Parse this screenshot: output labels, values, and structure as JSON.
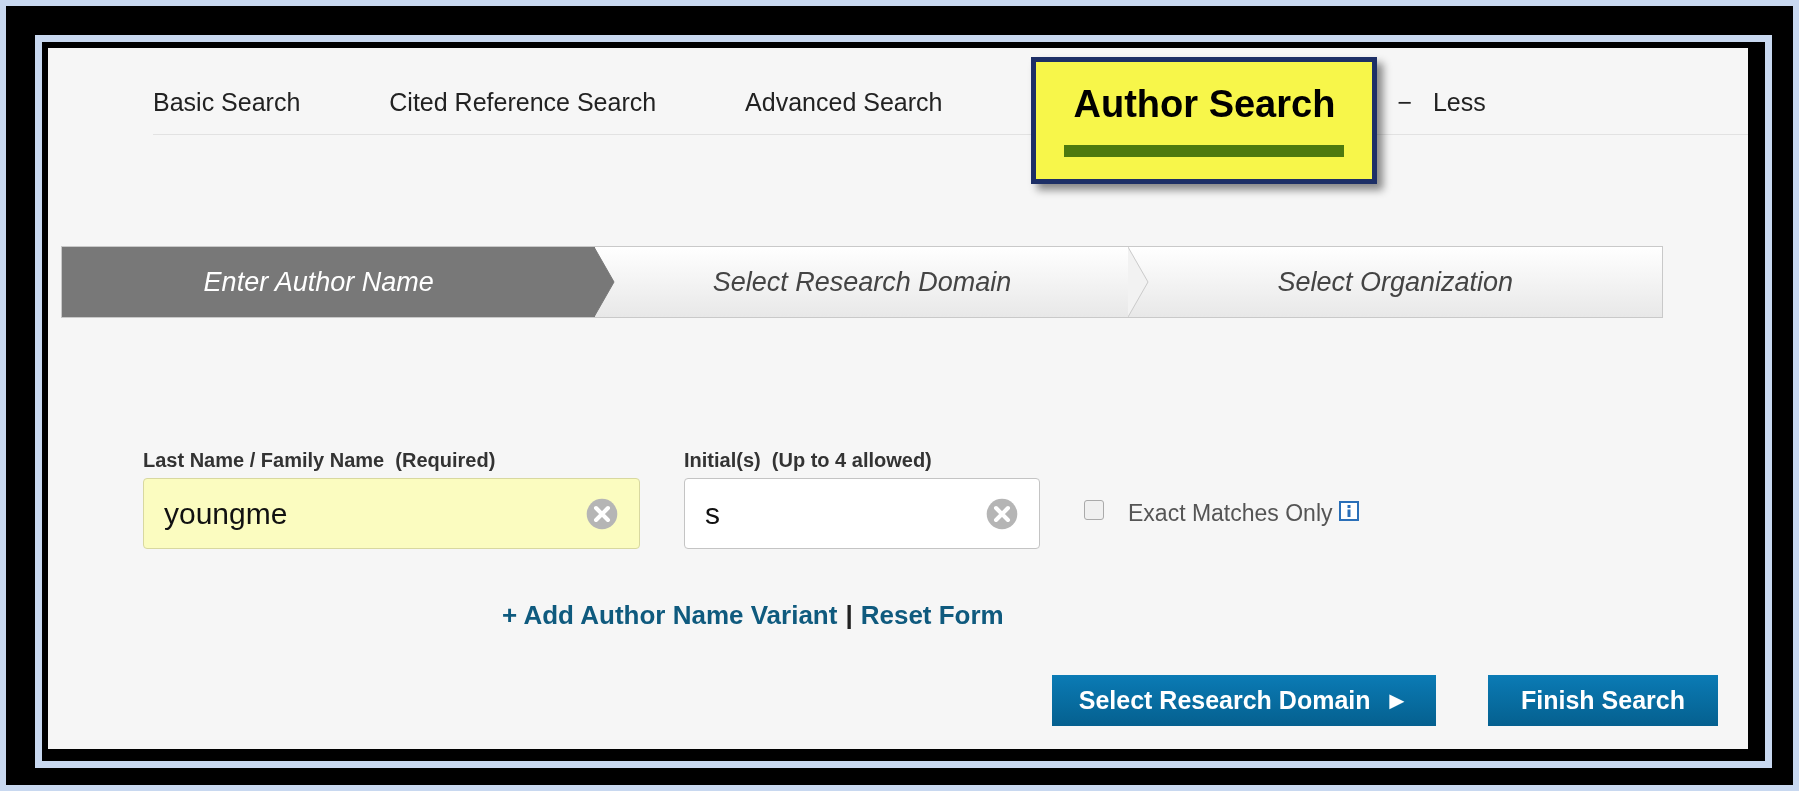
{
  "tabs": [
    {
      "label": "Basic Search",
      "selected": false
    },
    {
      "label": "Cited Reference Search",
      "selected": false
    },
    {
      "label": "Advanced Search",
      "selected": false
    },
    {
      "label": "Author Search",
      "selected": true
    }
  ],
  "less_toggle": {
    "icon": "−",
    "label": "Less"
  },
  "steps": [
    {
      "label": "Enter Author Name",
      "selected": true
    },
    {
      "label": "Select Research Domain",
      "selected": false
    },
    {
      "label": "Select Organization",
      "selected": false
    }
  ],
  "fields": [
    {
      "label": "Last Name / Family Name  (Required)",
      "value": "youngme",
      "highlighted": true
    },
    {
      "label": "Initial(s)  (Up to 4 allowed)",
      "value": "s",
      "highlighted": false
    }
  ],
  "exact_matches": {
    "label": "Exact Matches Only",
    "checked": false
  },
  "links": [
    {
      "label": "+ Add Author Name Variant"
    },
    {
      "label": "Reset Form"
    }
  ],
  "link_separator": "|",
  "buttons": [
    {
      "label": "Select Research Domain",
      "arrow": "►"
    },
    {
      "label": "Finish Search"
    }
  ]
}
